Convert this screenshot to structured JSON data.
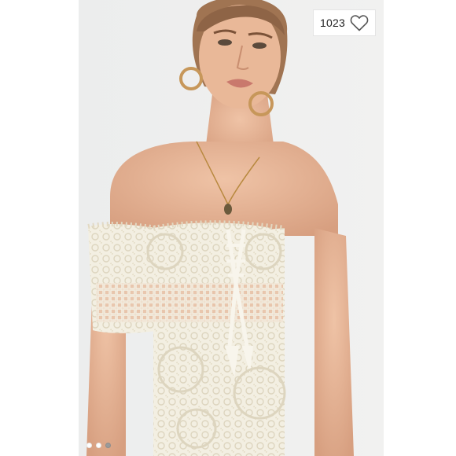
{
  "listing": {
    "like_count": "1023",
    "like_icon": "heart-outline-icon"
  },
  "carousel": {
    "slides": 3,
    "active_index": 0
  },
  "colors": {
    "photo_background": "#eeeeee",
    "dress": "#f3efe2",
    "skin": "#e3b293"
  }
}
